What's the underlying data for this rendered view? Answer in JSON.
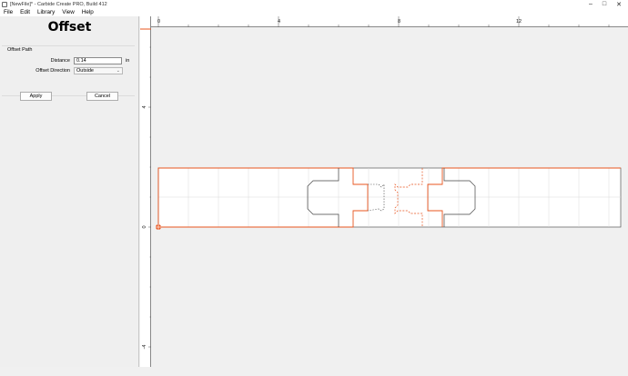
{
  "window": {
    "title": "[NewFile]* - Carbide Create PRO, Build 412",
    "minimize_glyph": "–",
    "maximize_glyph": "□",
    "close_glyph": "✕"
  },
  "menu": {
    "items": [
      "File",
      "Edit",
      "Library",
      "View",
      "Help"
    ]
  },
  "panel": {
    "heading": "Offset",
    "group_label": "Offset Path",
    "distance_label": "Distance",
    "distance_value": "0.14",
    "distance_unit": "in",
    "direction_label": "Offset Direction",
    "direction_value": "Outside",
    "apply_label": "Apply",
    "cancel_label": "Cancel"
  },
  "rulers": {
    "horizontal_ticks": [
      "0",
      "4",
      "8",
      "12"
    ],
    "vertical_ticks": [
      "4",
      "0",
      "-4"
    ]
  },
  "colors": {
    "selection": "#e8541e",
    "path": "#444444",
    "grid": "#d8d8d8",
    "stock": "#ffffff"
  },
  "icons": {
    "app": "carbide-create-icon",
    "origin": "origin-marker-icon"
  }
}
